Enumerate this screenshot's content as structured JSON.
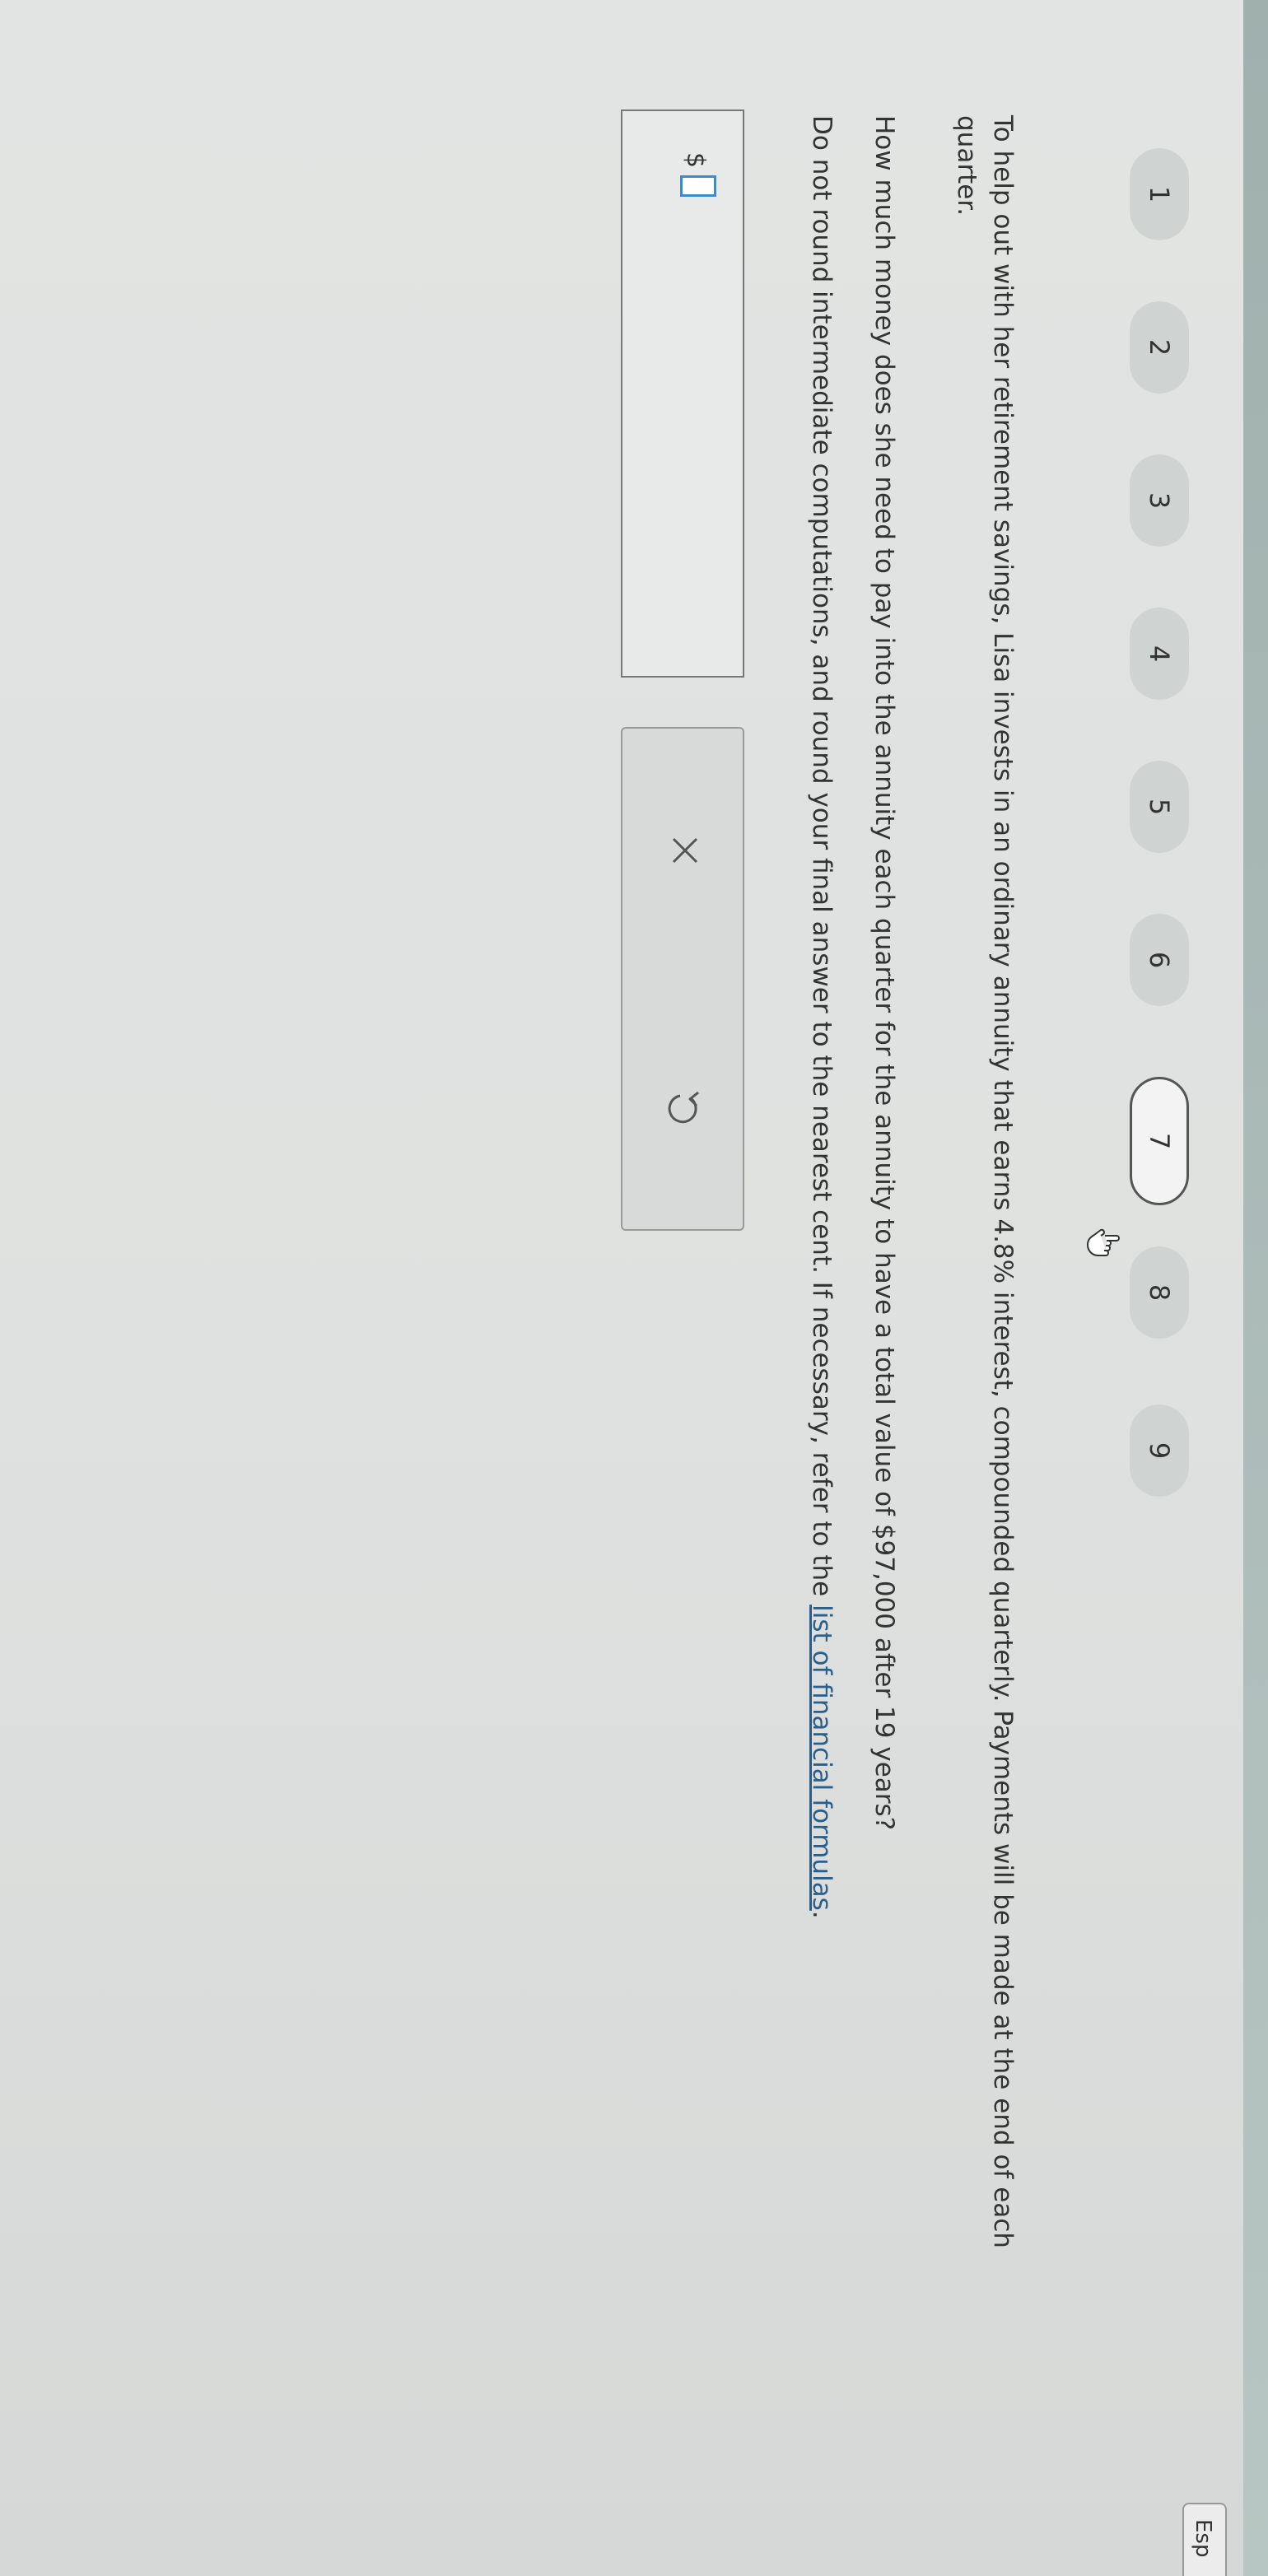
{
  "language_button": "Esp",
  "nav": {
    "items": [
      "1",
      "2",
      "3",
      "4",
      "5",
      "6",
      "7",
      "8",
      "9"
    ],
    "current_index": 6
  },
  "question": {
    "paragraph1": "To help out with her retirement savings, Lisa invests in an ordinary annuity that earns 4.8% interest, compounded quarterly. Payments will be made at the end of each quarter.",
    "paragraph2": "How much money does she need to pay into the annuity each quarter for the annuity to have a total value of $97,000 after 19 years?",
    "paragraph3_prefix": "Do not round intermediate computations, and round your final answer to the nearest cent. If necessary, refer to the ",
    "paragraph3_link": "list of financial formulas",
    "paragraph3_suffix": "."
  },
  "answer": {
    "currency_symbol": "$",
    "value": ""
  },
  "icons": {
    "clear": "x-icon",
    "undo": "undo-icon",
    "cursor": "hand-pointer-icon"
  },
  "colors": {
    "link": "#2b5f8a",
    "input_focus": "#3a8bd0"
  }
}
